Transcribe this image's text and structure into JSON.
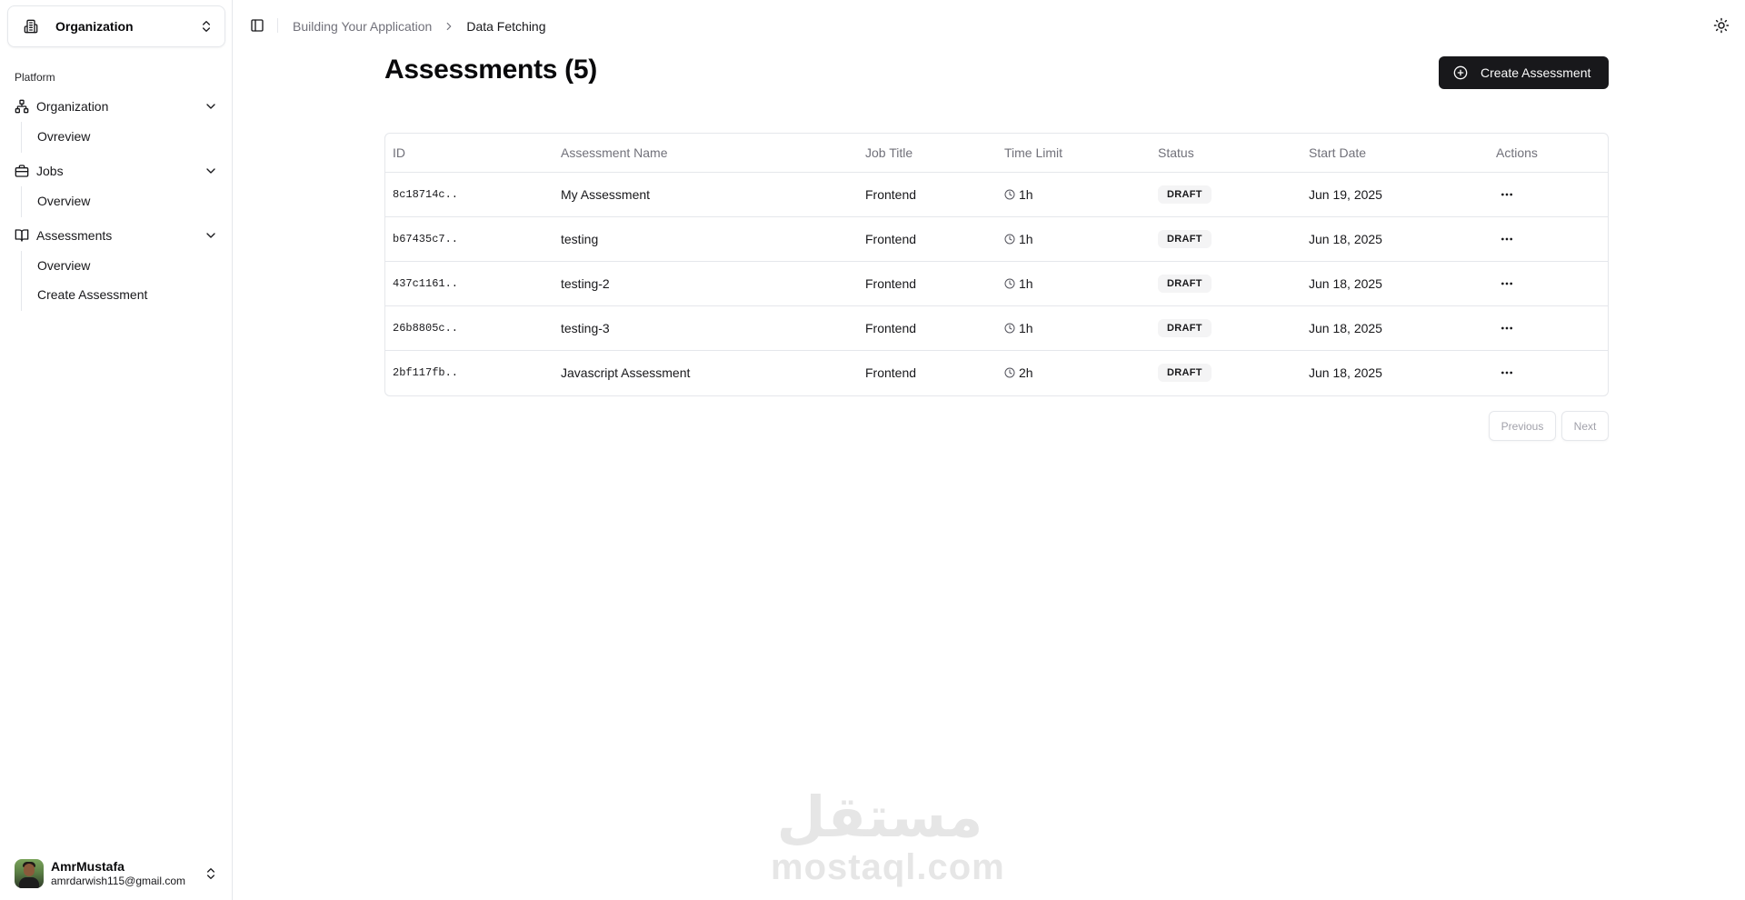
{
  "sidebar": {
    "org_switcher": {
      "label": "Organization"
    },
    "group_label": "Platform",
    "items": [
      {
        "label": "Organization",
        "icon": "network-icon",
        "sub": [
          "Ovreview"
        ]
      },
      {
        "label": "Jobs",
        "icon": "briefcase-icon",
        "sub": [
          "Overview"
        ]
      },
      {
        "label": "Assessments",
        "icon": "book-open-icon",
        "sub": [
          "Overview",
          "Create Assessment"
        ]
      }
    ],
    "user": {
      "name": "AmrMustafa",
      "email": "amrdarwish115@gmail.com"
    }
  },
  "header": {
    "breadcrumb": {
      "parent": "Building Your Application",
      "current": "Data Fetching"
    }
  },
  "main": {
    "title": "Assessments (5)",
    "create_button": "Create Assessment",
    "table": {
      "columns": [
        "ID",
        "Assessment Name",
        "Job Title",
        "Time Limit",
        "Status",
        "Start Date",
        "Actions"
      ],
      "rows": [
        {
          "id": "8c18714c..",
          "name": "My Assessment",
          "job": "Frontend",
          "time": "1h",
          "status": "DRAFT",
          "date": "Jun 19, 2025"
        },
        {
          "id": "b67435c7..",
          "name": "testing",
          "job": "Frontend",
          "time": "1h",
          "status": "DRAFT",
          "date": "Jun 18, 2025"
        },
        {
          "id": "437c1161..",
          "name": "testing-2",
          "job": "Frontend",
          "time": "1h",
          "status": "DRAFT",
          "date": "Jun 18, 2025"
        },
        {
          "id": "26b8805c..",
          "name": "testing-3",
          "job": "Frontend",
          "time": "1h",
          "status": "DRAFT",
          "date": "Jun 18, 2025"
        },
        {
          "id": "2bf117fb..",
          "name": "Javascript Assessment",
          "job": "Frontend",
          "time": "2h",
          "status": "DRAFT",
          "date": "Jun 18, 2025"
        }
      ]
    },
    "pagination": {
      "previous": "Previous",
      "next": "Next"
    }
  },
  "watermark": {
    "arabic": "مستقل",
    "latin": "mostaql.com"
  }
}
